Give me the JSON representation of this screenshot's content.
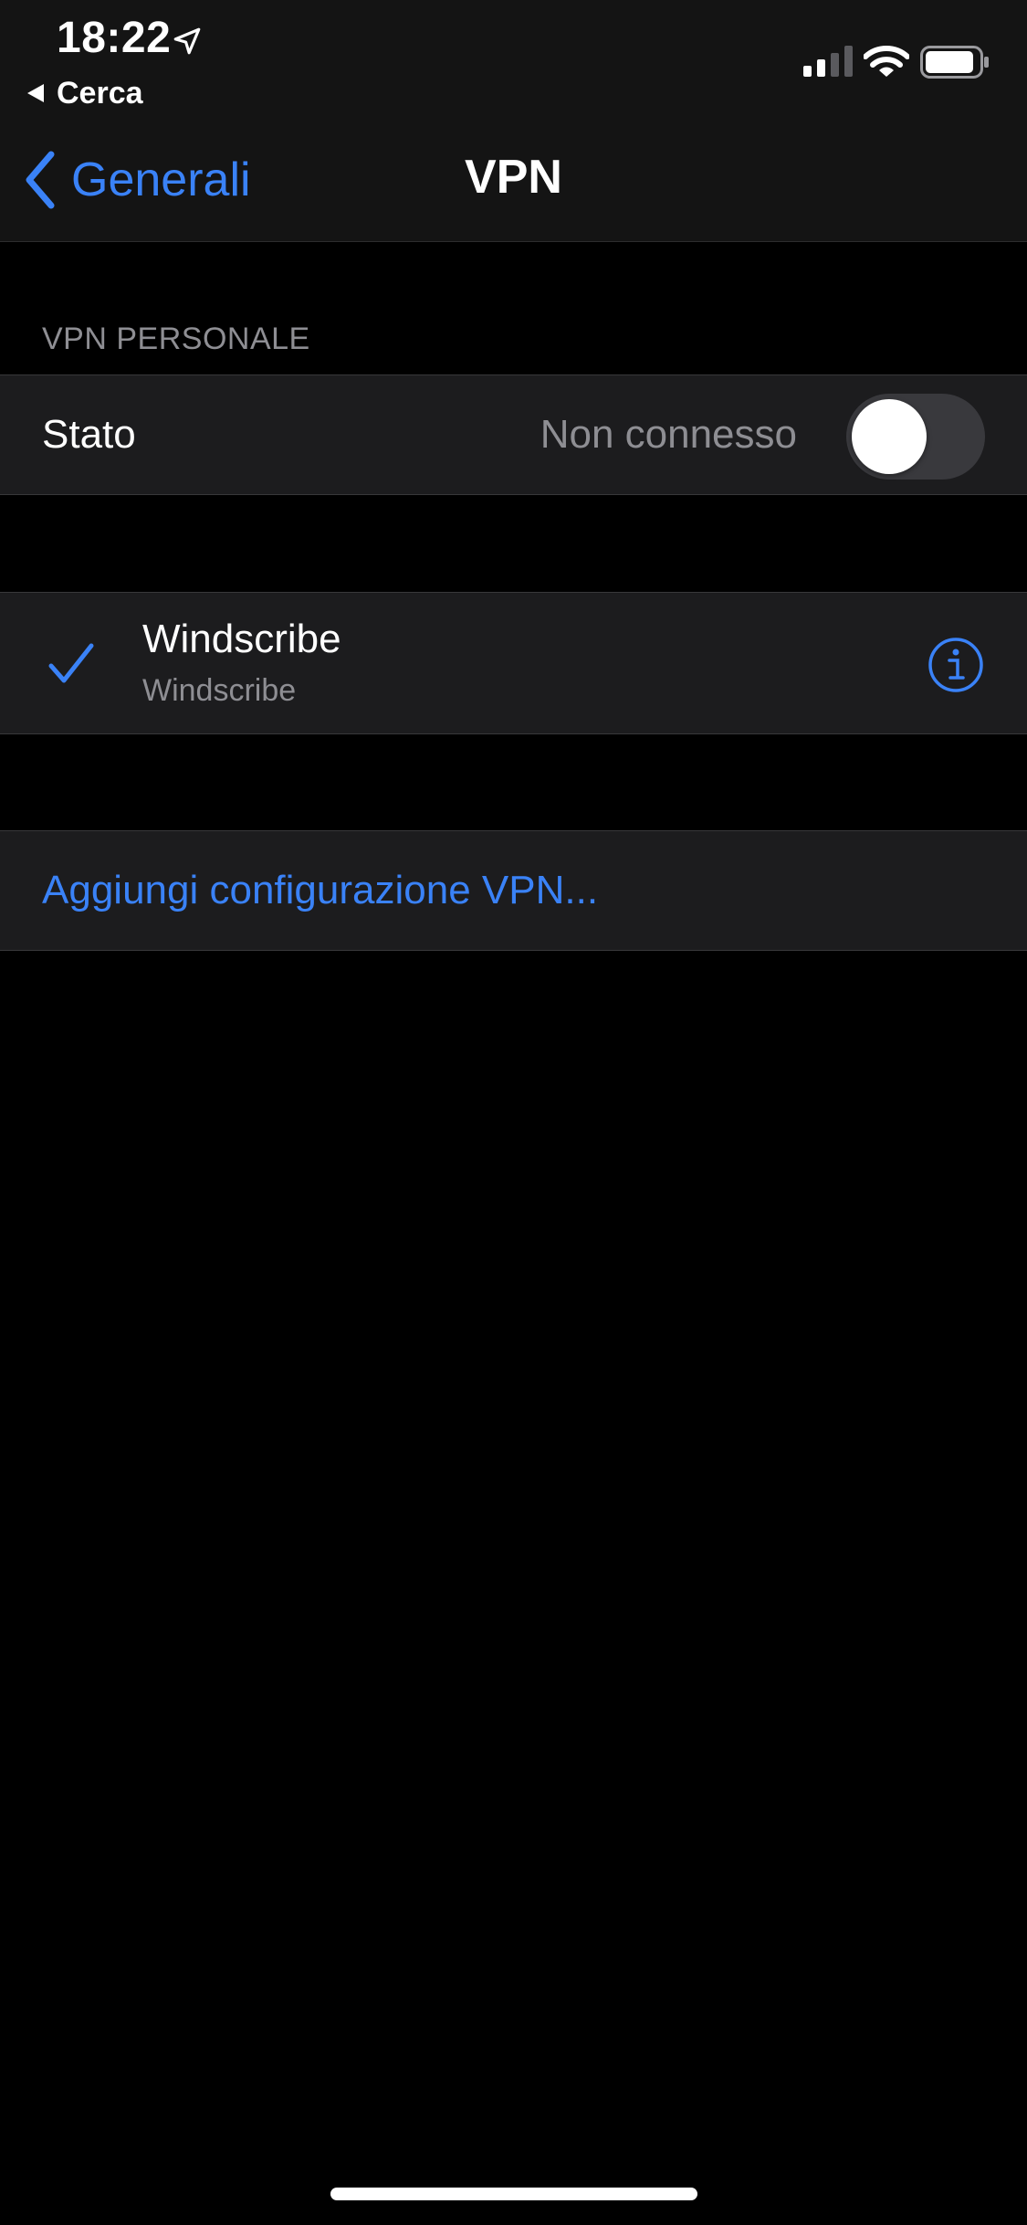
{
  "status_bar": {
    "time": "18:22",
    "back_app_label": "Cerca",
    "signal_bars": 2,
    "battery_level": 0.85
  },
  "nav": {
    "back_label": "Generali",
    "title": "VPN"
  },
  "personal_vpn": {
    "header": "VPN PERSONALE",
    "state_label": "Stato",
    "state_value": "Non connesso",
    "toggle_on": false
  },
  "vpn_config": {
    "name": "Windscribe",
    "subtitle": "Windscribe",
    "selected": true
  },
  "add_config": {
    "label": "Aggiungi configurazione VPN..."
  },
  "colors": {
    "accent": "#3a82f7",
    "background": "#000000",
    "cell": "#1c1c1e",
    "secondary_text": "#8e8e93"
  }
}
